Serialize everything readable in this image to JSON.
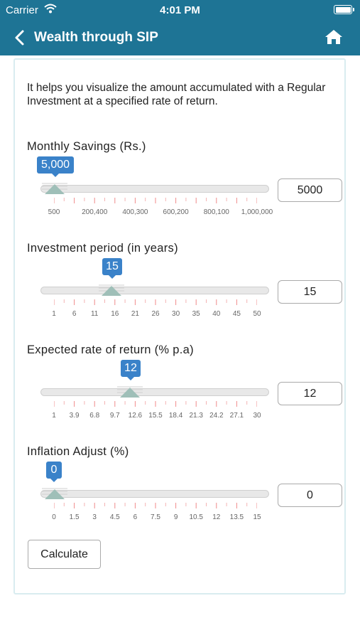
{
  "status_bar": {
    "carrier": "Carrier",
    "time": "4:01 PM"
  },
  "nav": {
    "title": "Wealth through SIP"
  },
  "intro": "It helps you visualize the amount accumulated with a Regular Investment at a specified rate of return.",
  "sliders": [
    {
      "label": "Monthly Savings (Rs.)",
      "bubble": "5,000",
      "value": "5000",
      "fraction": 0.0,
      "tick_labels": [
        "500",
        "200,400",
        "400,300",
        "600,200",
        "800,100",
        "1,000,000"
      ]
    },
    {
      "label": "Investment period (in years)",
      "bubble": "15",
      "value": "15",
      "fraction": 0.286,
      "tick_labels": [
        "1",
        "6",
        "11",
        "16",
        "21",
        "26",
        "30",
        "35",
        "40",
        "45",
        "50"
      ]
    },
    {
      "label": "Expected rate of return (% p.a)",
      "bubble": "12",
      "value": "12",
      "fraction": 0.379,
      "tick_labels": [
        "1",
        "3.9",
        "6.8",
        "9.7",
        "12.6",
        "15.5",
        "18.4",
        "21.3",
        "24.2",
        "27.1",
        "30"
      ]
    },
    {
      "label": "Inflation Adjust (%)",
      "bubble": "0",
      "value": "0",
      "fraction": 0.0,
      "tick_labels": [
        "0",
        "1.5",
        "3",
        "4.5",
        "6",
        "7.5",
        "9",
        "10.5",
        "12",
        "13.5",
        "15"
      ]
    }
  ],
  "calculate_label": "Calculate",
  "colors": {
    "header": "#1e7495",
    "bubble": "#3a82c9",
    "thumb": "#9fbfb8",
    "tick": "#f08a8a"
  }
}
